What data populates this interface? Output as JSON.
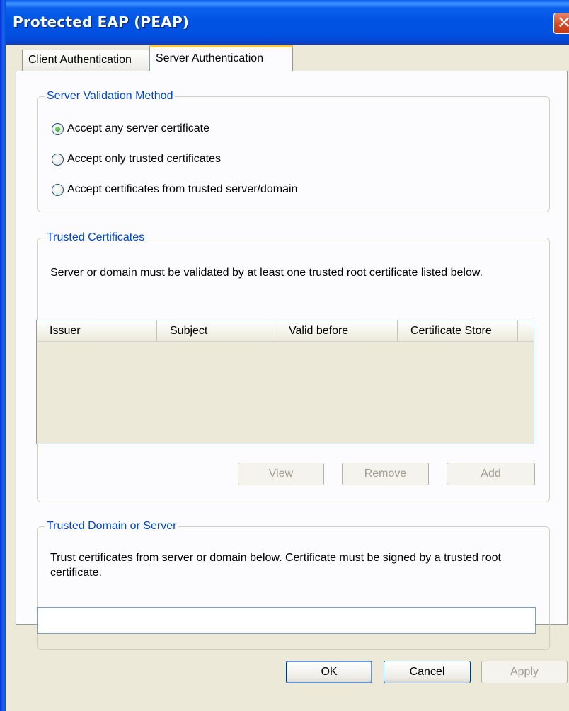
{
  "window": {
    "title": "Protected EAP (PEAP)",
    "close_glyph": "✕"
  },
  "tabs": [
    {
      "label": "Client Authentication",
      "active": false
    },
    {
      "label": "Server Authentication",
      "active": true
    }
  ],
  "server_validation": {
    "title": "Server Validation Method",
    "options": [
      {
        "label": "Accept any server certificate",
        "checked": true
      },
      {
        "label": "Accept only trusted certificates",
        "checked": false
      },
      {
        "label": "Accept certificates from trusted server/domain",
        "checked": false
      }
    ]
  },
  "trusted_certificates": {
    "title": "Trusted Certificates",
    "description": "Server or domain must be validated by at least one trusted root certificate listed below.",
    "columns": [
      "Issuer",
      "Subject",
      "Valid before",
      "Certificate Store"
    ],
    "rows": [],
    "buttons": {
      "view": "View",
      "remove": "Remove",
      "add": "Add"
    }
  },
  "trusted_domain": {
    "title": "Trusted Domain or Server",
    "description": "Trust certificates from server or domain below. Certificate must be signed by a trusted root certificate.",
    "value": ""
  },
  "footer": {
    "ok": "OK",
    "cancel": "Cancel",
    "apply": "Apply"
  },
  "colors": {
    "titlebar": "#0054e3",
    "group_title": "#0046d5",
    "dialog_bg": "#ece9d8",
    "panel_bg": "#fcfcfe",
    "tab_highlight": "#ffc83c"
  }
}
